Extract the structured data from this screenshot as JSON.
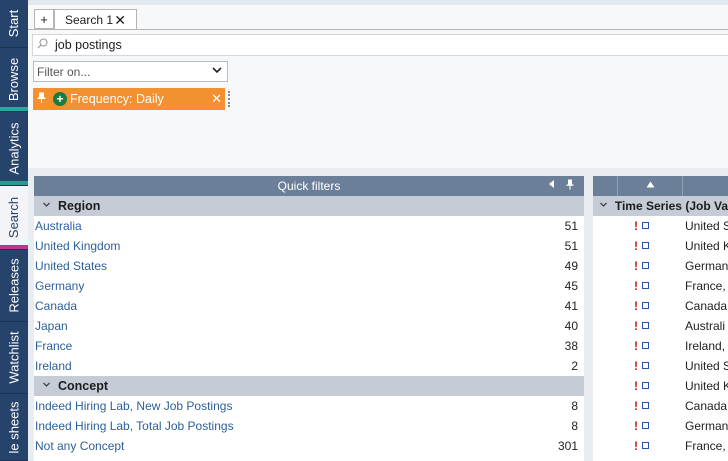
{
  "sidebar": {
    "tabs": [
      {
        "label": "Start"
      },
      {
        "label": "Browse"
      },
      {
        "label": "Analytics"
      },
      {
        "label": "Search"
      },
      {
        "label": "Releases"
      },
      {
        "label": "Watchlist"
      },
      {
        "label": "le sheets"
      }
    ],
    "active": "Search",
    "accent_colors": {
      "Browse": "#2ea6a0",
      "Analytics": "#2a9a8a",
      "Search": "#c2328f"
    }
  },
  "tabs": {
    "add_label": "+",
    "items": [
      {
        "label": "Search 1",
        "close": "✕"
      }
    ]
  },
  "search": {
    "value": "job postings",
    "icon": "search-icon"
  },
  "filter": {
    "placeholder": "Filter on...",
    "chevron": "⌄"
  },
  "active_filter": {
    "label": "Frequency: Daily",
    "close": "✕",
    "pin": "pin-icon",
    "add": "+"
  },
  "quick_filters": {
    "title": "Quick filters",
    "groups": [
      {
        "label": "Region",
        "items": [
          {
            "label": "Australia",
            "count": "51"
          },
          {
            "label": "United Kingdom",
            "count": "51"
          },
          {
            "label": "United States",
            "count": "49"
          },
          {
            "label": "Germany",
            "count": "45"
          },
          {
            "label": "Canada",
            "count": "41"
          },
          {
            "label": "Japan",
            "count": "40"
          },
          {
            "label": "France",
            "count": "38"
          },
          {
            "label": "Ireland",
            "count": "2"
          }
        ]
      },
      {
        "label": "Concept",
        "items": [
          {
            "label": "Indeed Hiring Lab, New Job Postings",
            "count": "8"
          },
          {
            "label": "Indeed Hiring Lab, Total Job Postings",
            "count": "8"
          },
          {
            "label": "Not any Concept",
            "count": "301"
          }
        ]
      }
    ]
  },
  "results": {
    "group_label": "Time Series (Job Va",
    "rows": [
      {
        "flag": "!",
        "name": "United S"
      },
      {
        "flag": "!",
        "name": "United K"
      },
      {
        "flag": "!",
        "name": "Germany"
      },
      {
        "flag": "!",
        "name": "France, T"
      },
      {
        "flag": "!",
        "name": "Canada,"
      },
      {
        "flag": "!",
        "name": "Australi"
      },
      {
        "flag": "!",
        "name": "Ireland,"
      },
      {
        "flag": "!",
        "name": "United S"
      },
      {
        "flag": "!",
        "name": "United K"
      },
      {
        "flag": "!",
        "name": "Canada,"
      },
      {
        "flag": "!",
        "name": "Germany"
      },
      {
        "flag": "!",
        "name": "France, I"
      }
    ]
  }
}
